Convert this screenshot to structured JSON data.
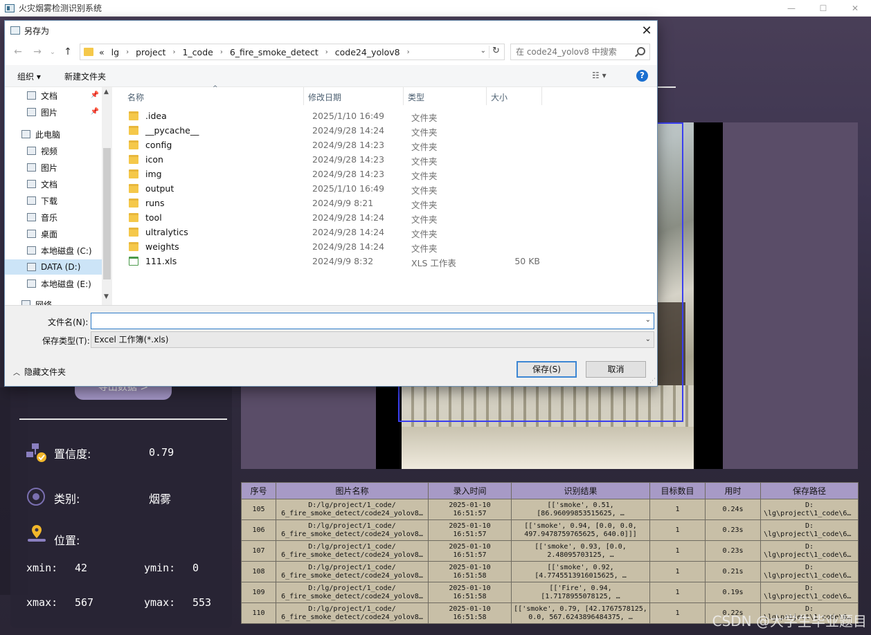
{
  "app": {
    "title": "火灾烟雾检测识别系统",
    "min_symbol": "—",
    "max_symbol": "☐",
    "close_symbol": "✕",
    "export_button": "导出数据 >"
  },
  "info": {
    "confidence_label": "置信度:",
    "confidence_value": "0.79",
    "class_label": "类别:",
    "class_value": "烟雾",
    "location_label": "位置:",
    "xmin_label": "xmin:",
    "xmin_value": "42",
    "ymin_label": "ymin:",
    "ymin_value": "0",
    "xmax_label": "xmax:",
    "xmax_value": "567",
    "ymax_label": "ymax:",
    "ymax_value": "553"
  },
  "table": {
    "headers": [
      "序号",
      "图片名称",
      "录入时间",
      "识别结果",
      "目标数目",
      "用时",
      "保存路径"
    ],
    "rows": [
      {
        "id": "105",
        "name1": "D:/lg/project/1_code/",
        "name2": "6_fire_smoke_detect/code24_yolov8…",
        "t1": "2025-01-10",
        "t2": "16:51:57",
        "r1": "[['smoke', 0.51,",
        "r2": "[86.96099853515625, …",
        "count": "1",
        "time": "0.24s",
        "p1": "D:",
        "p2": "\\lg\\project\\1_code\\6…"
      },
      {
        "id": "106",
        "name1": "D:/lg/project/1_code/",
        "name2": "6_fire_smoke_detect/code24_yolov8…",
        "t1": "2025-01-10",
        "t2": "16:51:57",
        "r1": "[['smoke', 0.94, [0.0, 0.0,",
        "r2": "497.9478759765625, 640.0]]]",
        "count": "1",
        "time": "0.23s",
        "p1": "D:",
        "p2": "\\lg\\project\\1_code\\6…"
      },
      {
        "id": "107",
        "name1": "D:/lg/project/1_code/",
        "name2": "6_fire_smoke_detect/code24_yolov8…",
        "t1": "2025-01-10",
        "t2": "16:51:57",
        "r1": "[['smoke', 0.93, [0.0,",
        "r2": "2.48095703125, …",
        "count": "1",
        "time": "0.23s",
        "p1": "D:",
        "p2": "\\lg\\project\\1_code\\6…"
      },
      {
        "id": "108",
        "name1": "D:/lg/project/1_code/",
        "name2": "6_fire_smoke_detect/code24_yolov8…",
        "t1": "2025-01-10",
        "t2": "16:51:58",
        "r1": "[['smoke', 0.92,",
        "r2": "[4.7745513916015625, …",
        "count": "1",
        "time": "0.21s",
        "p1": "D:",
        "p2": "\\lg\\project\\1_code\\6…"
      },
      {
        "id": "109",
        "name1": "D:/lg/project/1_code/",
        "name2": "6_fire_smoke_detect/code24_yolov8…",
        "t1": "2025-01-10",
        "t2": "16:51:58",
        "r1": "[['Fire', 0.94,",
        "r2": "[1.7178955078125, …",
        "count": "1",
        "time": "0.19s",
        "p1": "D:",
        "p2": "\\lg\\project\\1_code\\6…"
      },
      {
        "id": "110",
        "name1": "D:/lg/project/1_code/",
        "name2": "6_fire_smoke_detect/code24_yolov8…",
        "t1": "2025-01-10",
        "t2": "16:51:58",
        "r1": "[['smoke', 0.79, [42.1767578125,",
        "r2": "0.0, 567.6243896484375, …",
        "count": "1",
        "time": "0.22s",
        "p1": "D:",
        "p2": "\\lg\\project\\1_code\\6…"
      }
    ]
  },
  "watermark": "CSDN @大学生毕业题目",
  "dialog": {
    "title": "另存为",
    "close_symbol": "✕",
    "back_symbol": "←",
    "forward_symbol": "→",
    "recent_symbol": "⌄",
    "up_symbol": "↑",
    "breadcrumb": [
      "«",
      "lg",
      "project",
      "1_code",
      "6_fire_smoke_detect",
      "code24_yolov8"
    ],
    "refresh_symbol": "↻",
    "search_placeholder": "在 code24_yolov8 中搜索",
    "toolbar": {
      "organize": "组织 ▾",
      "new_folder": "新建文件夹",
      "view": "☷ ▾",
      "help": "?"
    },
    "nav_pane": [
      {
        "label": "文档",
        "pinned": "📌"
      },
      {
        "label": "图片",
        "pinned": "📌"
      },
      {
        "label": "此电脑",
        "pinned": ""
      },
      {
        "label": "视频",
        "pinned": ""
      },
      {
        "label": "图片",
        "pinned": ""
      },
      {
        "label": "文档",
        "pinned": ""
      },
      {
        "label": "下载",
        "pinned": ""
      },
      {
        "label": "音乐",
        "pinned": ""
      },
      {
        "label": "桌面",
        "pinned": ""
      },
      {
        "label": "本地磁盘 (C:)",
        "pinned": ""
      },
      {
        "label": "DATA (D:)",
        "pinned": ""
      },
      {
        "label": "本地磁盘 (E:)",
        "pinned": ""
      },
      {
        "label": "网络",
        "pinned": ""
      }
    ],
    "columns": {
      "name": "名称",
      "date": "修改日期",
      "type": "类型",
      "size": "大小"
    },
    "files": [
      {
        "name": ".idea",
        "date": "2025/1/10 16:49",
        "type": "文件夹",
        "size": ""
      },
      {
        "name": "__pycache__",
        "date": "2024/9/28 14:24",
        "type": "文件夹",
        "size": ""
      },
      {
        "name": "config",
        "date": "2024/9/28 14:23",
        "type": "文件夹",
        "size": ""
      },
      {
        "name": "icon",
        "date": "2024/9/28 14:23",
        "type": "文件夹",
        "size": ""
      },
      {
        "name": "img",
        "date": "2024/9/28 14:23",
        "type": "文件夹",
        "size": ""
      },
      {
        "name": "output",
        "date": "2025/1/10 16:49",
        "type": "文件夹",
        "size": ""
      },
      {
        "name": "runs",
        "date": "2024/9/9 8:21",
        "type": "文件夹",
        "size": ""
      },
      {
        "name": "tool",
        "date": "2024/9/28 14:24",
        "type": "文件夹",
        "size": ""
      },
      {
        "name": "ultralytics",
        "date": "2024/9/28 14:24",
        "type": "文件夹",
        "size": ""
      },
      {
        "name": "weights",
        "date": "2024/9/28 14:24",
        "type": "文件夹",
        "size": ""
      },
      {
        "name": "111.xls",
        "date": "2024/9/9 8:32",
        "type": "XLS 工作表",
        "size": "50 KB"
      }
    ],
    "filename_label": "文件名(N):",
    "filename_value": "",
    "filetype_label": "保存类型(T):",
    "filetype_value": "Excel 工作簿(*.xls)",
    "hide_folders": "隐藏文件夹",
    "save_button": "保存(S)",
    "cancel_button": "取消"
  }
}
